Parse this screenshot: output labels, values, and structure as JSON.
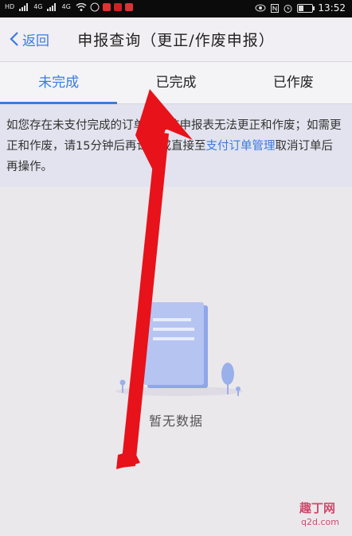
{
  "status_bar": {
    "left_badges": [
      "HD",
      "4G",
      "4G",
      "HD"
    ],
    "time": "13:52",
    "battery_level": 0.3
  },
  "nav": {
    "back_label": "返回",
    "title": "申报查询（更正/作废申报）"
  },
  "tabs": [
    {
      "label": "未完成",
      "active": true
    },
    {
      "label": "已完成",
      "active": false
    },
    {
      "label": "已作废",
      "active": false
    }
  ],
  "notice": {
    "text_before": "如您存在未支付完成的订单，则该申报表无法更正和作废；如需更正和作废，请15分钟后再试，或直接至",
    "link_text": "支付订单管理",
    "text_after": "取消订单后再操作。"
  },
  "empty_state": {
    "text": "暂无数据"
  },
  "colors": {
    "accent": "#3a7be0",
    "arrow": "#e8121a",
    "background": "#ebe8ec"
  },
  "watermark": {
    "line1": "趣丁网",
    "line2": "q2d.com"
  }
}
